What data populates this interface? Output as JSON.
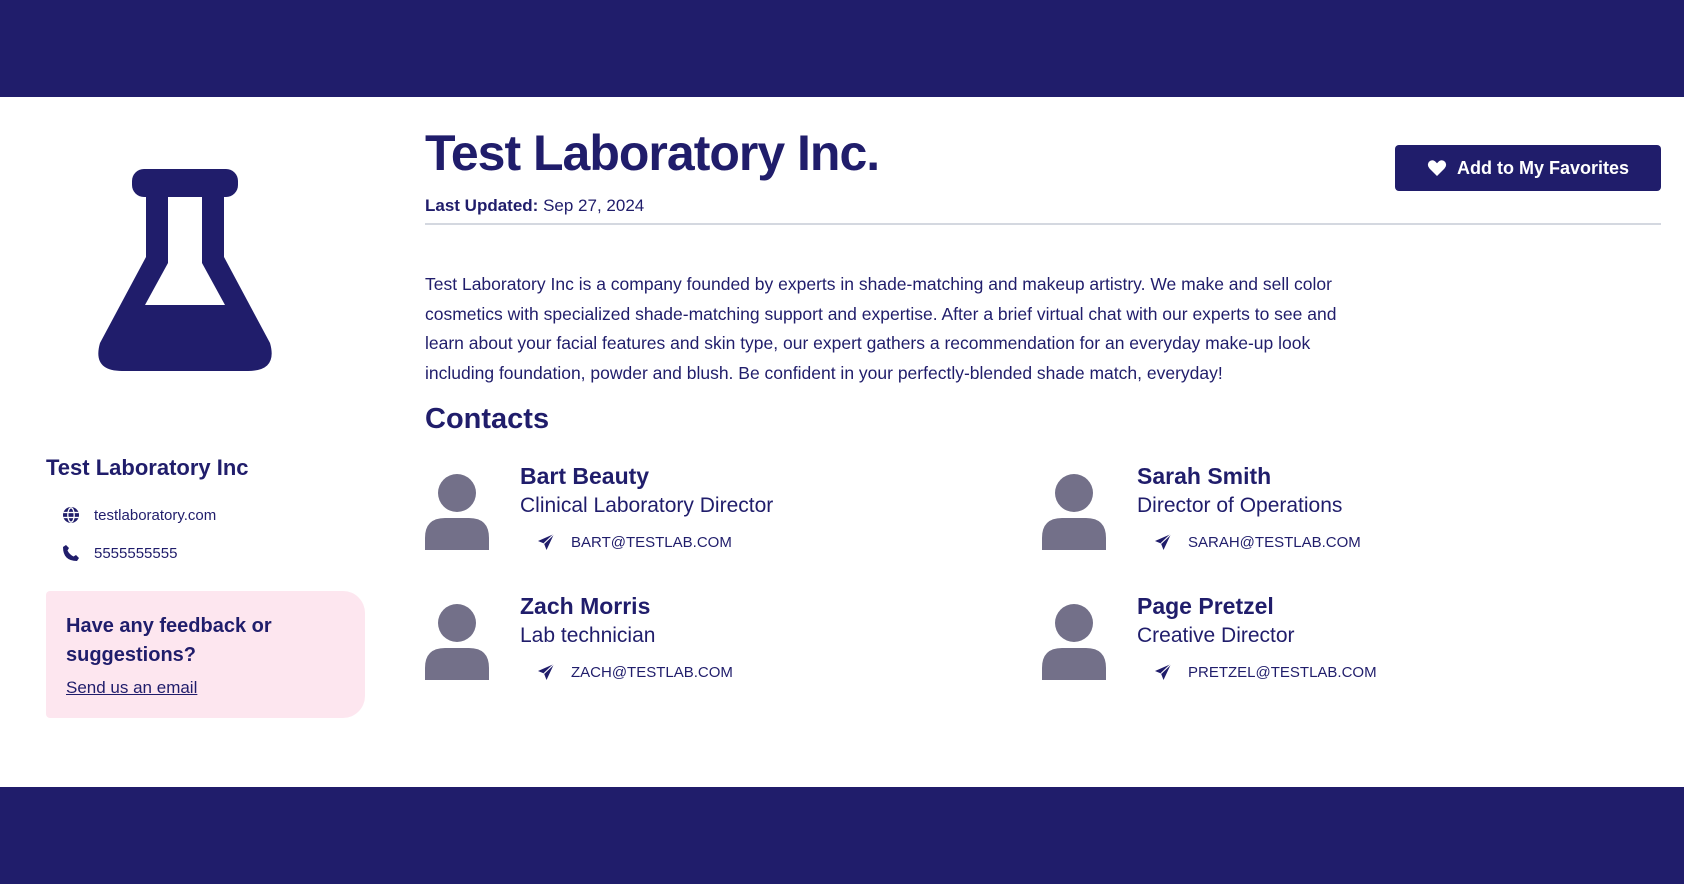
{
  "colors": {
    "brand": "#201d6b",
    "avatar": "#737089",
    "feedback_bg": "#fde6ef",
    "divider": "#d4d8e0"
  },
  "sidebar": {
    "logo_icon": "flask-icon",
    "org_name": "Test Laboratory Inc",
    "website": "testlaboratory.com",
    "phone": "5555555555",
    "feedback": {
      "heading": "Have any feedback or suggestions?",
      "link": "Send us an email"
    }
  },
  "main": {
    "title": "Test Laboratory Inc.",
    "last_updated_label": "Last Updated:",
    "last_updated_value": "Sep 27, 2024",
    "favorite_button": "Add to My Favorites",
    "description": "Test Laboratory Inc is a company founded by experts in shade-matching and makeup artistry. We make and sell color cosmetics with specialized shade-matching support and expertise. After a brief virtual chat with our experts to see and learn about your facial features and skin type, our expert gathers a recommendation for an everyday make-up look including foundation, powder and blush. Be confident in your perfectly-blended shade match, everyday!",
    "contacts_heading": "Contacts",
    "contacts": [
      {
        "name": "Bart Beauty",
        "role": "Clinical Laboratory Director",
        "email": "BART@TESTLAB.COM"
      },
      {
        "name": "Sarah Smith",
        "role": "Director of Operations",
        "email": "SARAH@TESTLAB.COM"
      },
      {
        "name": "Zach Morris",
        "role": "Lab technician",
        "email": "ZACH@TESTLAB.COM"
      },
      {
        "name": "Page Pretzel",
        "role": "Creative Director",
        "email": "PRETZEL@TESTLAB.COM"
      }
    ]
  }
}
